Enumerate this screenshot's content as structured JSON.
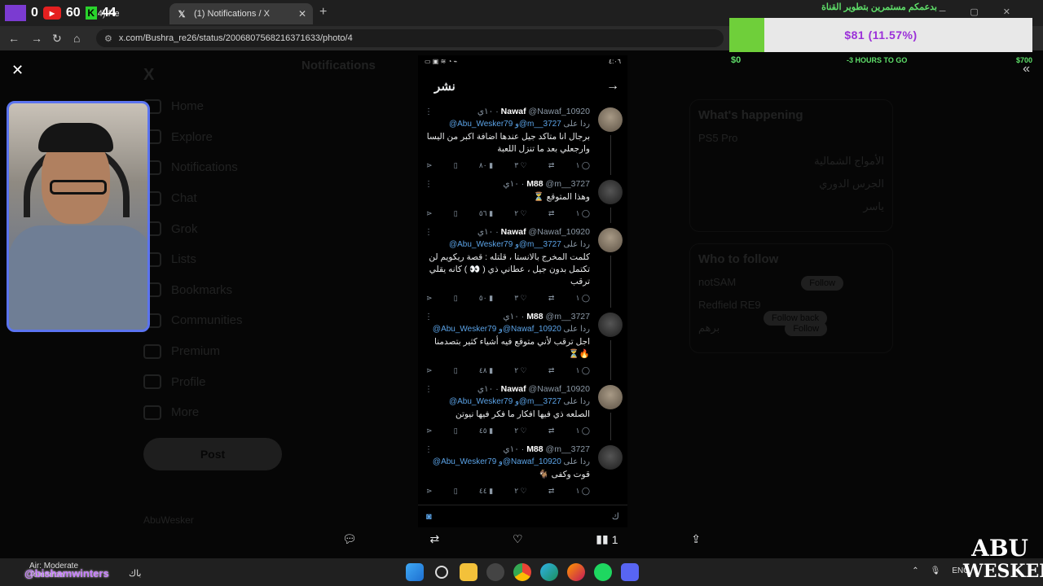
{
  "browser": {
    "tabs": [
      {
        "label": "(24) Re",
        "active": false
      },
      {
        "label": "(1) Notifications / X",
        "active": true
      }
    ],
    "url": "x.com/Bushra_re26/status/2006807568216371633/photo/4"
  },
  "stream_stats": {
    "count_a": "0",
    "yt_count": "60",
    "kick_count": "44",
    "kick_label": "K"
  },
  "donation": {
    "title": "بدعمكم مستمرين بتطوير القناة",
    "amount_text": "$81 (11.57%)",
    "progress": 0.1157,
    "min": "$0",
    "countdown": "-3 HOURS TO GO",
    "max": "$700"
  },
  "x_background": {
    "logo": "X",
    "nav": [
      "Home",
      "Explore",
      "Notifications",
      "Chat",
      "Grok",
      "Lists",
      "Bookmarks",
      "Communities",
      "Premium",
      "Profile",
      "More"
    ],
    "post_button": "Post",
    "account": "AbuWesker",
    "notifications_title": "Notifications",
    "whats_happening": "What's happening",
    "trend1": "PS5 Pro",
    "trend_ar1": "الأمواج الشمالية",
    "trend_ar2": "الجرس الدوري",
    "trend_ar3": "ياسر",
    "who_to_follow": "Who to follow",
    "follow_items": [
      "notSAM",
      "Redfield RE9",
      "برهم"
    ],
    "follow_label": "Follow",
    "follow_back_label": "Follow back"
  },
  "phone": {
    "status_left": "٤:٠٦",
    "header_title": "نشر",
    "tweets": [
      {
        "name": "Nawaf",
        "handle": "@Nawaf_10920 · ١٠ي",
        "reply_prefix": "ردا على",
        "reply_to": "@Abu_Wesker79 و@m__3727",
        "text": "برجال انا متاكد جيل عندها اضافة اكبر من اليسا وارجعلي بعد ما تنزل اللعبة",
        "replies": "١",
        "retweets": "",
        "likes": "٣",
        "views": "٨٠",
        "avatar": "nawaf"
      },
      {
        "name": "M88",
        "handle": "@m__3727 · ١٠ي",
        "reply_prefix": "",
        "reply_to": "",
        "text": "وهذا المتوقع ⏳",
        "replies": "١",
        "retweets": "",
        "likes": "٢",
        "views": "٥٦",
        "avatar": "m88"
      },
      {
        "name": "Nawaf",
        "handle": "@Nawaf_10920 · ١٠ي",
        "reply_prefix": "ردا على",
        "reply_to": "@Abu_Wesker79 و@m__3727",
        "text": "كلمت المخرج بالانستا ، قلتله : قصة ريكويم لن تكتمل بدون جيل ، عطاني ذي ( 👀 ) كانه يقلي ترقب",
        "replies": "١",
        "retweets": "",
        "likes": "٣",
        "views": "٥٠",
        "avatar": "nawaf"
      },
      {
        "name": "M88",
        "handle": "@m__3727 · ١٠ي",
        "reply_prefix": "ردا على",
        "reply_to": "@Abu_Wesker79 و@Nawaf_10920",
        "text": "اجل ترقب لأني متوقع فيه أشياء كثير بتصدمنا 🔥⏳",
        "replies": "١",
        "retweets": "",
        "likes": "٢",
        "views": "٤٨",
        "avatar": "m88"
      },
      {
        "name": "Nawaf",
        "handle": "@Nawaf_10920 · ١٠ي",
        "reply_prefix": "ردا على",
        "reply_to": "@Abu_Wesker79 و@m__3727",
        "text": "الصلعه ذي فيها افكار ما فكر فيها نيوتن",
        "replies": "١",
        "retweets": "",
        "likes": "٢",
        "views": "٤٥",
        "avatar": "nawaf"
      },
      {
        "name": "M88",
        "handle": "@m__3727 · ١٠ي",
        "reply_prefix": "ردا على",
        "reply_to": "@Abu_Wesker79 و@Nawaf_10920",
        "text": "قوت وكفى 🐐",
        "replies": "١",
        "retweets": "",
        "likes": "٢",
        "views": "٤٤",
        "avatar": "m88"
      }
    ],
    "compose_placeholder": "ك"
  },
  "viewer_actions": {
    "views": "1"
  },
  "taskbar": {
    "weather": "Air: Moderate",
    "weather_sub": "Tomorrow",
    "handle": "@bishamwinters",
    "handle2": "باك",
    "lang": "ENG"
  },
  "brand": {
    "line1": "ABU",
    "line2": "WESKER"
  },
  "colors": {
    "accent_blue": "#5ba3e7",
    "donation_green": "#6fcf3a",
    "donation_text": "#9b30d9",
    "cam_border": "#5b74f0"
  }
}
